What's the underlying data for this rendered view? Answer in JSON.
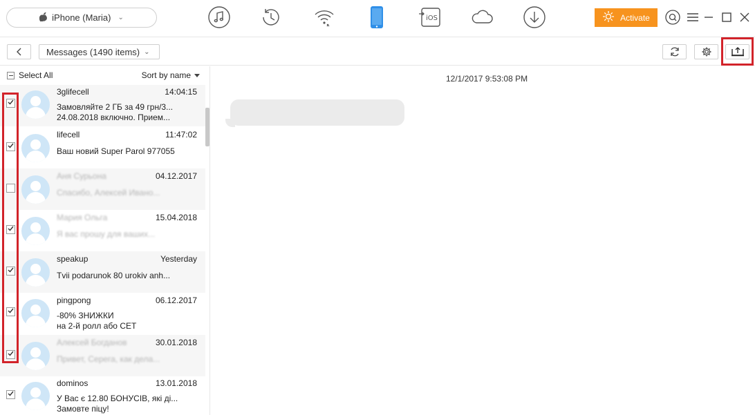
{
  "topbar": {
    "device_name": "iPhone (Maria)",
    "tools": [
      "music-icon",
      "history-icon",
      "wifi-icon",
      "phone-icon",
      "to-ios-icon",
      "cloud-icon",
      "download-icon"
    ],
    "to_ios_label": "iOS",
    "activate_label": "Activate",
    "accent_color": "#f7931e",
    "active_tool_color": "#2f8fe8"
  },
  "subbar": {
    "category_label": "Messages (1490 items)"
  },
  "list": {
    "select_all_label": "Select All",
    "sort_label": "Sort by name",
    "items": [
      {
        "name": "3glifecell",
        "time": "14:04:15",
        "line1": "Замовляйте 2 ГБ за 49 грн/3...",
        "line2": "24.08.2018 включно. Прием...",
        "checked": true,
        "blurred": false
      },
      {
        "name": "lifecell",
        "time": "11:47:02",
        "line1": "Ваш новий Super Parol 977055",
        "line2": "",
        "checked": true,
        "blurred": false
      },
      {
        "name": "Аня Сурьона",
        "time": "04.12.2017",
        "line1": "Спасибо, Алексей Ивано...",
        "line2": "",
        "checked": false,
        "blurred": true
      },
      {
        "name": "Мария Ольга",
        "time": "15.04.2018",
        "line1": "Я вас прошу для ваших...",
        "line2": "",
        "checked": true,
        "blurred": true
      },
      {
        "name": "speakup",
        "time": "Yesterday",
        "line1": "Tvii podarunok 80 urokiv anh...",
        "line2": "",
        "checked": true,
        "blurred": false
      },
      {
        "name": "pingpong",
        "time": "06.12.2017",
        "line1": "-80% ЗНИЖКИ",
        "line2": "на 2-й ролл або СЕТ",
        "checked": true,
        "blurred": false
      },
      {
        "name": "Алексей Богданов",
        "time": "30.01.2018",
        "line1": "Привет, Серега, как дела...",
        "line2": "",
        "checked": true,
        "blurred": true
      },
      {
        "name": "dominos",
        "time": "13.01.2018",
        "line1": "У Вас є 12.80 БОНУСІВ, які ді...",
        "line2": "Замовте піцу!",
        "checked": true,
        "blurred": false
      }
    ]
  },
  "conversation": {
    "date": "12/1/2017 9:53:08 PM"
  },
  "highlight_color": "#d2232a"
}
